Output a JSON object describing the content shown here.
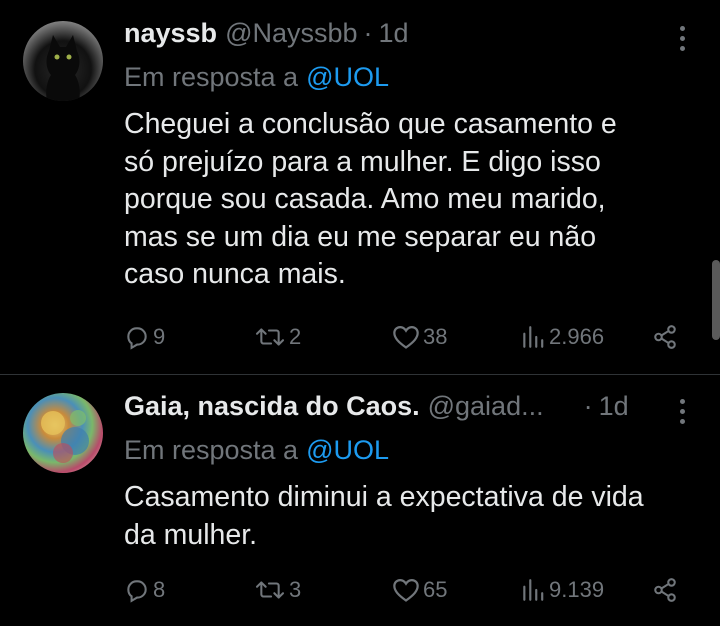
{
  "tweets": [
    {
      "name": "nayssb",
      "handle": "@Nayssbb",
      "dot": "·",
      "time": "1d",
      "reply_prefix": "Em resposta a",
      "reply_mention": "@UOL",
      "body_lines": [
        "Cheguei a conclusão que casamento e",
        "só prejuízo para a mulher. E digo isso",
        "porque sou casada. Amo meu marido,",
        "mas se um dia eu me separar eu não",
        "caso nunca mais."
      ],
      "stats": {
        "replies": "9",
        "retweets": "2",
        "likes": "38",
        "views": "2.966"
      },
      "avatar": "black-cat-avatar"
    },
    {
      "name": "Gaia, nascida do Caos.",
      "handle": "@gaiad...",
      "dot": "·",
      "time": "1d",
      "reply_prefix": "Em resposta a",
      "reply_mention": "@UOL",
      "body_lines": [
        "Casamento diminui a expectativa de vida",
        "da mulher."
      ],
      "stats": {
        "replies": "8",
        "retweets": "3",
        "likes": "65",
        "views": "9.139"
      },
      "avatar": "painting-avatar"
    }
  ],
  "colors": {
    "background": "#000000",
    "text": "#e7e9ea",
    "muted": "#71767b",
    "link": "#1d9bf0",
    "divider": "#2f3336"
  }
}
